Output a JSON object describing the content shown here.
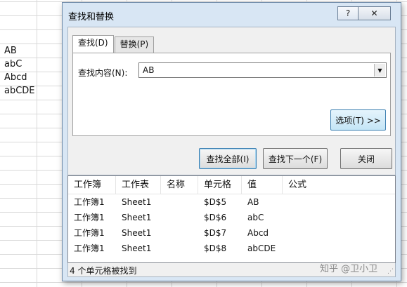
{
  "sheet": {
    "cells": [
      "AB",
      "abC",
      "Abcd",
      "abCDE"
    ]
  },
  "dialog": {
    "title": "查找和替换",
    "help_label": "?",
    "close_label": "✕",
    "tabs": [
      {
        "label": "查找(D)",
        "active": true
      },
      {
        "label": "替换(P)",
        "active": false
      }
    ],
    "find_label": "查找内容(N):",
    "find_value": "AB",
    "options_label": "选项(T) >>",
    "buttons": {
      "find_all": "查找全部(I)",
      "find_next": "查找下一个(F)",
      "close": "关闭"
    },
    "results": {
      "columns": [
        "工作簿",
        "工作表",
        "名称",
        "单元格",
        "值",
        "公式"
      ],
      "rows": [
        {
          "workbook": "工作簿1",
          "sheet": "Sheet1",
          "name": "",
          "cell": "$D$5",
          "value": "AB",
          "formula": ""
        },
        {
          "workbook": "工作簿1",
          "sheet": "Sheet1",
          "name": "",
          "cell": "$D$6",
          "value": "abC",
          "formula": ""
        },
        {
          "workbook": "工作簿1",
          "sheet": "Sheet1",
          "name": "",
          "cell": "$D$7",
          "value": "Abcd",
          "formula": ""
        },
        {
          "workbook": "工作簿1",
          "sheet": "Sheet1",
          "name": "",
          "cell": "$D$8",
          "value": "abCDE",
          "formula": ""
        }
      ]
    },
    "status": "4 个单元格被找到"
  },
  "watermark": "知乎 @卫小卫"
}
